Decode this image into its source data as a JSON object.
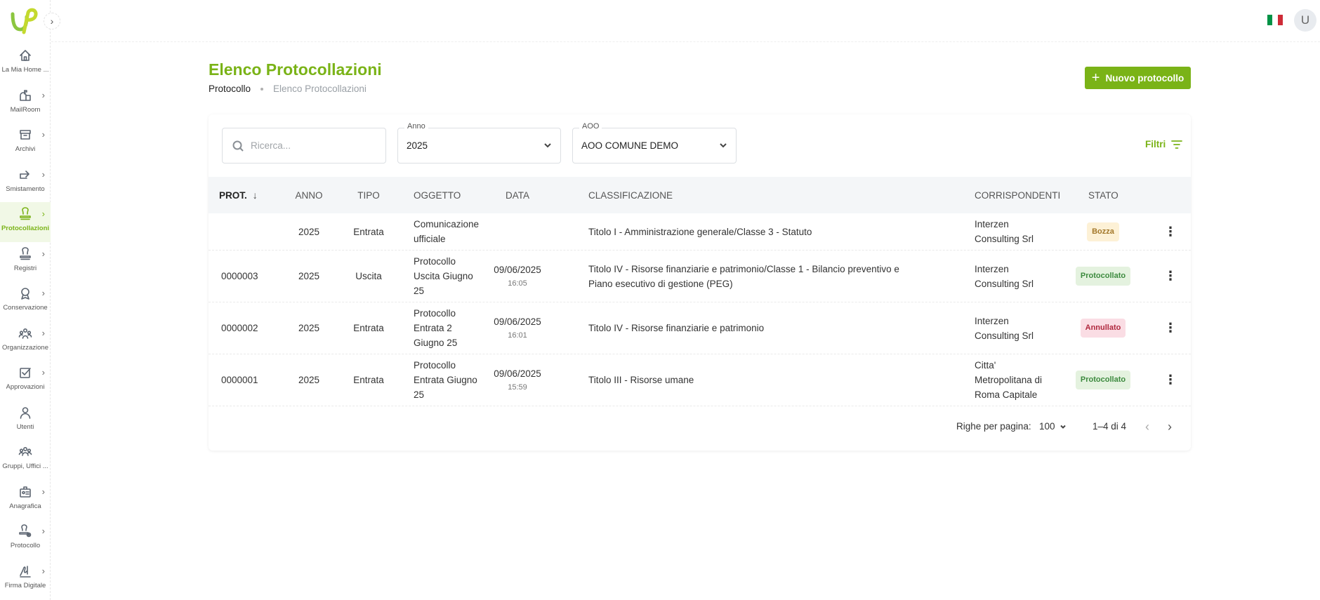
{
  "app": {
    "user_initial": "U",
    "accent_color": "#7ab317",
    "flag_colors": [
      "#009246",
      "#ffffff",
      "#ce2b37"
    ]
  },
  "sidebar": {
    "items": [
      {
        "label": "La Mia Home ...",
        "icon": "home-icon",
        "chevron": false
      },
      {
        "label": "MailRoom",
        "icon": "mailbox-icon",
        "chevron": true
      },
      {
        "label": "Archivi",
        "icon": "archive-icon",
        "chevron": true
      },
      {
        "label": "Smistamento",
        "icon": "forward-icon",
        "chevron": true
      },
      {
        "label": "Protocollazioni",
        "icon": "stamp-icon",
        "chevron": true,
        "active": true
      },
      {
        "label": "Registri",
        "icon": "stamp-icon",
        "chevron": true
      },
      {
        "label": "Conservazione",
        "icon": "award-icon",
        "chevron": true
      },
      {
        "label": "Organizzazione",
        "icon": "team-icon",
        "chevron": true
      },
      {
        "label": "Approvazioni",
        "icon": "checkbox-icon",
        "chevron": true
      },
      {
        "label": "Utenti",
        "icon": "user-icon",
        "chevron": false
      },
      {
        "label": "Gruppi, Uffici ...",
        "icon": "users-group-icon",
        "chevron": false
      },
      {
        "label": "Anagrafica",
        "icon": "id-card-icon",
        "chevron": true
      },
      {
        "label": "Protocollo",
        "icon": "stamp-settings-icon",
        "chevron": true
      },
      {
        "label": "Firma Digitale",
        "icon": "signature-icon",
        "chevron": true
      }
    ]
  },
  "header": {
    "title": "Elenco Protocollazioni",
    "breadcrumb": {
      "root": "Protocollo",
      "current": "Elenco Protocollazioni"
    },
    "new_button": "Nuovo protocollo"
  },
  "filters": {
    "search_placeholder": "Ricerca...",
    "anno": {
      "label": "Anno",
      "value": "2025"
    },
    "aoo": {
      "label": "AOO",
      "value": "AOO COMUNE DEMO"
    },
    "filtri_label": "Filtri"
  },
  "table": {
    "headers": {
      "prot": "PROT.",
      "anno": "ANNO",
      "tipo": "TIPO",
      "oggetto": "OGGETTO",
      "data": "DATA",
      "classificazione": "CLASSIFICAZIONE",
      "corrispondenti": "CORRISPONDENTI",
      "stato": "STATO"
    },
    "rows": [
      {
        "prot": "",
        "anno": "2025",
        "tipo": "Entrata",
        "oggetto": "Comunicazione ufficiale",
        "data": "",
        "ora": "",
        "classificazione": "Titolo I - Amministrazione generale/Classe 3 - Statuto",
        "corrispondenti": "Interzen Consulting Srl",
        "stato": "Bozza",
        "stato_type": "bozza"
      },
      {
        "prot": "0000003",
        "anno": "2025",
        "tipo": "Uscita",
        "oggetto": "Protocollo Uscita Giugno 25",
        "data": "09/06/2025",
        "ora": "16:05",
        "classificazione": "Titolo IV - Risorse finanziarie e patrimonio/Classe 1 - Bilancio preventivo e Piano esecutivo di gestione (PEG)",
        "corrispondenti": "Interzen Consulting Srl",
        "stato": "Protocollato",
        "stato_type": "protocollato"
      },
      {
        "prot": "0000002",
        "anno": "2025",
        "tipo": "Entrata",
        "oggetto": "Protocollo Entrata 2 Giugno 25",
        "data": "09/06/2025",
        "ora": "16:01",
        "classificazione": "Titolo IV - Risorse finanziarie e patrimonio",
        "corrispondenti": "Interzen Consulting Srl",
        "stato": "Annullato",
        "stato_type": "annullato"
      },
      {
        "prot": "0000001",
        "anno": "2025",
        "tipo": "Entrata",
        "oggetto": "Protocollo Entrata Giugno 25",
        "data": "09/06/2025",
        "ora": "15:59",
        "classificazione": "Titolo III - Risorse umane",
        "corrispondenti": "Citta' Metropolitana di Roma Capitale",
        "stato": "Protocollato",
        "stato_type": "protocollato"
      }
    ]
  },
  "pagination": {
    "rows_per_page_label": "Righe per pagina:",
    "rows_per_page": "100",
    "range": "1–4 di 4"
  }
}
